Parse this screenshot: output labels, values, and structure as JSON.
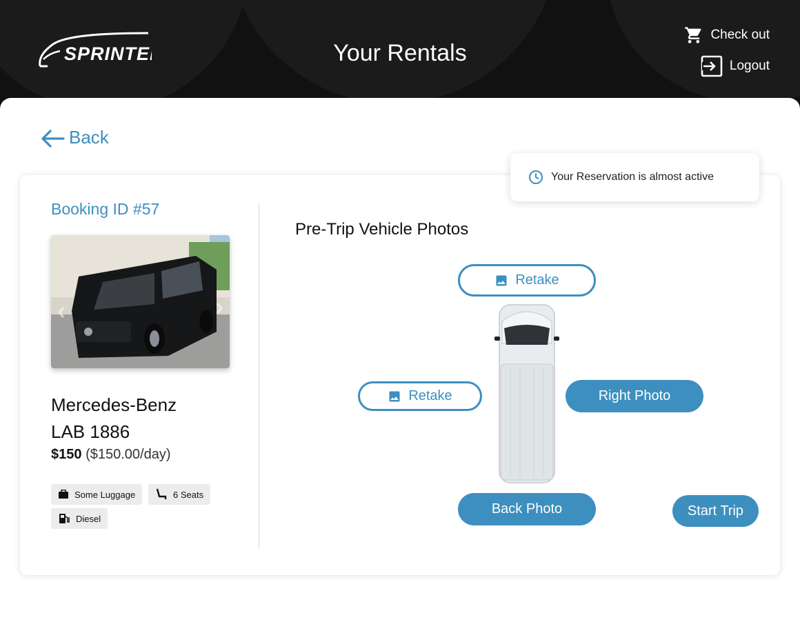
{
  "header": {
    "brand": "SPRINTER",
    "title": "Your Rentals",
    "checkout_label": "Check out",
    "logout_label": "Logout"
  },
  "nav": {
    "back_label": "Back"
  },
  "toast": {
    "message": "Your Reservation is almost active"
  },
  "booking": {
    "id_label": "Booking ID #57",
    "vehicle_make": "Mercedes-Benz",
    "vehicle_model": "LAB 1886",
    "price_main": "$150",
    "price_rate": "($150.00/day)",
    "features": [
      {
        "label": "Some Luggage",
        "icon": "luggage-icon"
      },
      {
        "label": "6 Seats",
        "icon": "seat-icon"
      },
      {
        "label": "Diesel",
        "icon": "fuel-pump-icon"
      }
    ]
  },
  "photos": {
    "title": "Pre-Trip Vehicle Photos",
    "front_button": "Retake",
    "left_button": "Retake",
    "right_button": "Right Photo",
    "back_button": "Back Photo",
    "start_button": "Start Trip"
  },
  "colors": {
    "accent": "#3d8fbf",
    "header_bg": "#111111",
    "tag_bg": "#ececec"
  }
}
